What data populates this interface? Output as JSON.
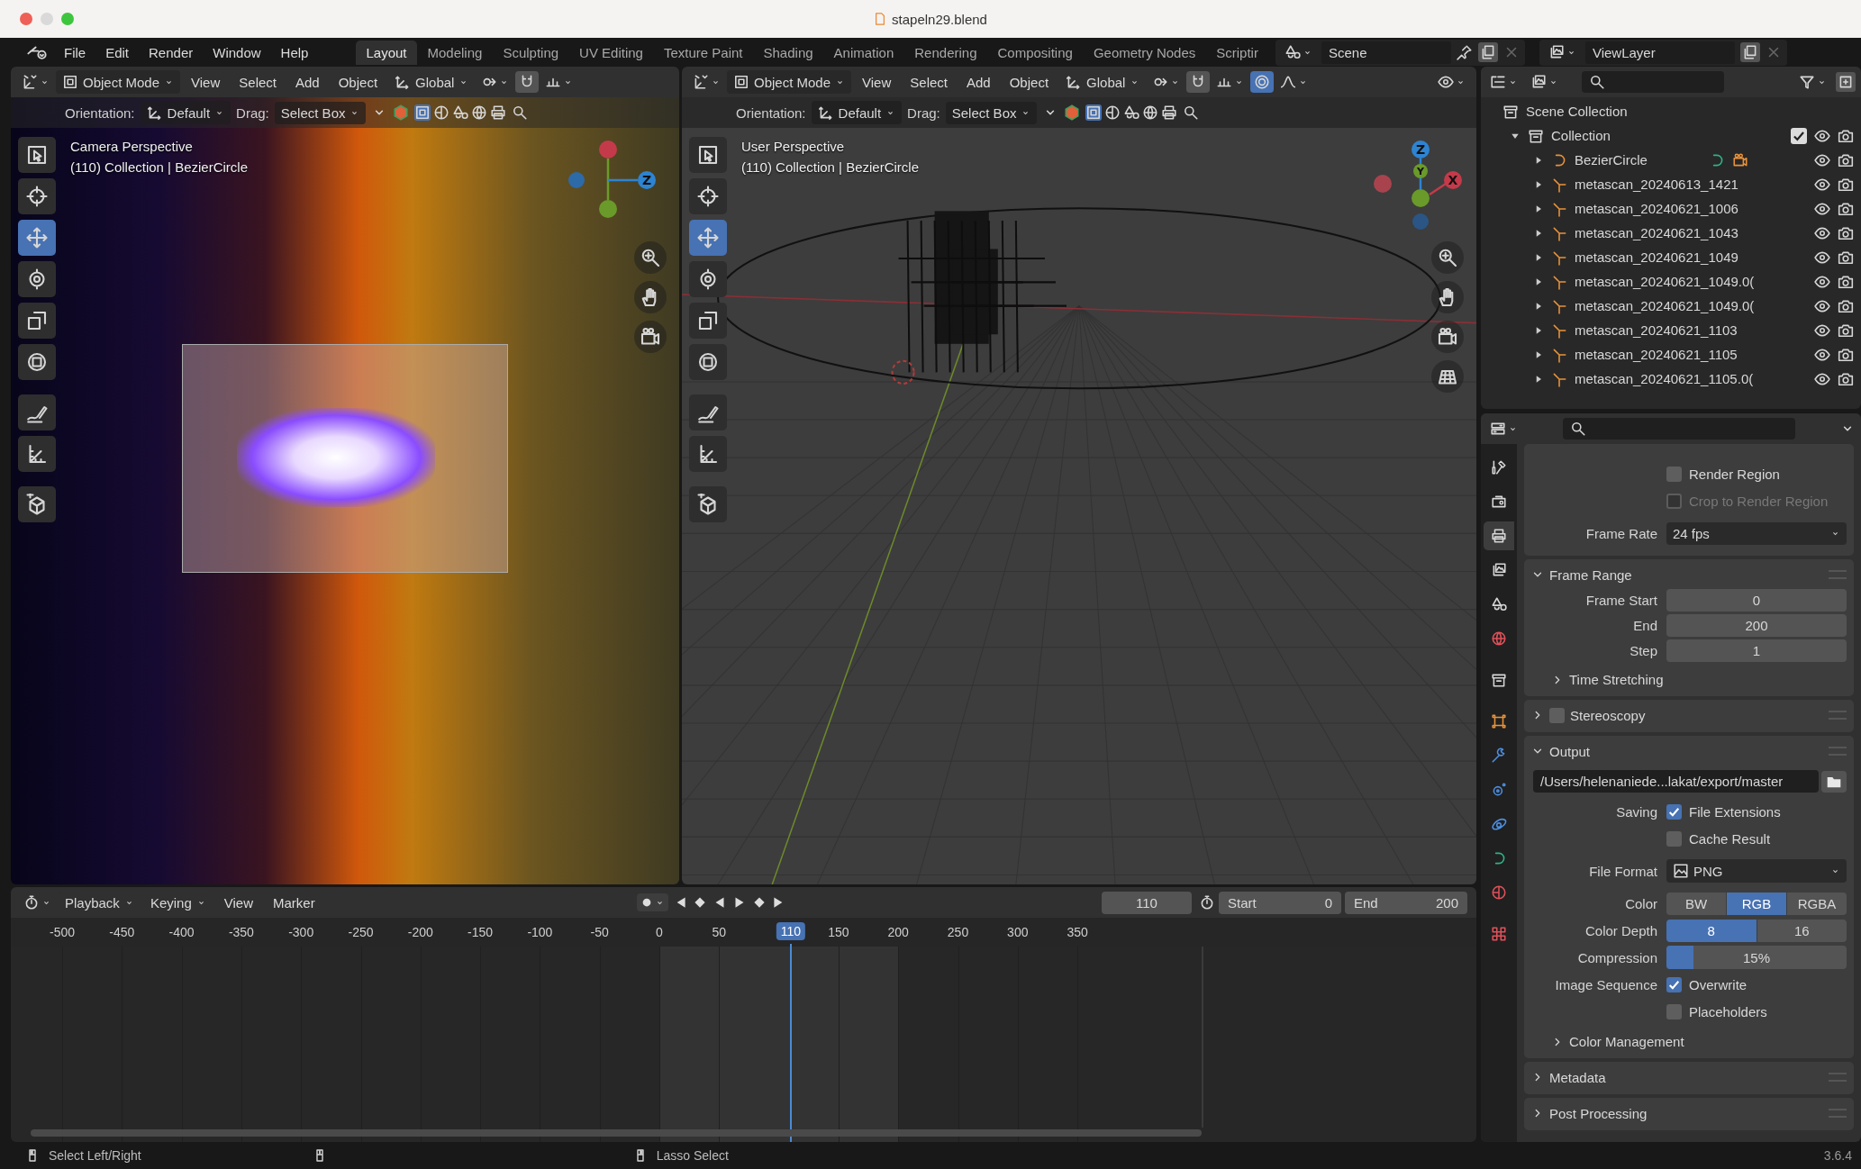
{
  "window": {
    "title": "stapeln29.blend"
  },
  "menu": [
    "File",
    "Edit",
    "Render",
    "Window",
    "Help"
  ],
  "workspaces": [
    {
      "label": "Layout",
      "selected": true
    },
    {
      "label": "Modeling",
      "selected": false
    },
    {
      "label": "Sculpting",
      "selected": false
    },
    {
      "label": "UV Editing",
      "selected": false
    },
    {
      "label": "Texture Paint",
      "selected": false
    },
    {
      "label": "Shading",
      "selected": false
    },
    {
      "label": "Animation",
      "selected": false
    },
    {
      "label": "Rendering",
      "selected": false
    },
    {
      "label": "Compositing",
      "selected": false
    },
    {
      "label": "Geometry Nodes",
      "selected": false
    },
    {
      "label": "Scriptir",
      "selected": false
    }
  ],
  "scene": {
    "value": "Scene"
  },
  "view_layer": {
    "value": "ViewLayer"
  },
  "viewports": [
    {
      "kind": "camera",
      "mode": "Object Mode",
      "menus": [
        "View",
        "Select",
        "Add",
        "Object"
      ],
      "transform": "Global",
      "orientation_label": "Orientation:",
      "orientation": "Default",
      "drag_label": "Drag:",
      "drag": "Select Box",
      "overlay_title": "Camera Perspective",
      "overlay_info": "(110) Collection | BezierCircle",
      "gizmo": [
        "Z"
      ],
      "tools": [
        {
          "kind": "select",
          "selected": false
        },
        {
          "kind": "cursor",
          "selected": false
        },
        {
          "kind": "move",
          "selected": true
        },
        {
          "kind": "rotate",
          "selected": false
        },
        {
          "kind": "scale",
          "selected": false
        },
        {
          "kind": "transform",
          "selected": false
        },
        {
          "kind": "annotate",
          "selected": false
        },
        {
          "kind": "measure",
          "selected": false
        },
        {
          "kind": "add-cube",
          "selected": false
        }
      ],
      "nav": [
        {
          "kind": "zoom"
        },
        {
          "kind": "pan"
        },
        {
          "kind": "camera"
        }
      ]
    },
    {
      "kind": "user",
      "mode": "Object Mode",
      "menus": [
        "View",
        "Select",
        "Add",
        "Object"
      ],
      "transform": "Global",
      "orientation_label": "Orientation:",
      "orientation": "Default",
      "drag_label": "Drag:",
      "drag": "Select Box",
      "overlay_title": "User Perspective",
      "overlay_info": "(110) Collection | BezierCircle",
      "gizmo": [
        "Z",
        "Y",
        "X"
      ],
      "tools": [
        {
          "kind": "select",
          "selected": false
        },
        {
          "kind": "cursor",
          "selected": false
        },
        {
          "kind": "move",
          "selected": true
        },
        {
          "kind": "rotate",
          "selected": false
        },
        {
          "kind": "scale",
          "selected": false
        },
        {
          "kind": "transform",
          "selected": false
        },
        {
          "kind": "annotate",
          "selected": false
        },
        {
          "kind": "measure",
          "selected": false
        },
        {
          "kind": "add-cube",
          "selected": false
        }
      ],
      "nav": [
        {
          "kind": "zoom"
        },
        {
          "kind": "pan"
        },
        {
          "kind": "camera"
        },
        {
          "kind": "grid"
        }
      ]
    }
  ],
  "outliner": {
    "root": "Scene Collection",
    "items": [
      {
        "label": "Collection",
        "kind": "collection",
        "expanded": true,
        "checked": true,
        "children": [
          {
            "label": "BezierCircle",
            "kind": "curve",
            "expanded": false
          },
          {
            "label": "metascan_20240613_1421",
            "kind": "armature",
            "expanded": false
          },
          {
            "label": "metascan_20240621_1006",
            "kind": "armature",
            "expanded": false
          },
          {
            "label": "metascan_20240621_1043",
            "kind": "armature",
            "expanded": false
          },
          {
            "label": "metascan_20240621_1049",
            "kind": "armature",
            "expanded": false
          },
          {
            "label": "metascan_20240621_1049.0(",
            "kind": "armature",
            "expanded": false
          },
          {
            "label": "metascan_20240621_1049.0(",
            "kind": "armature",
            "expanded": false
          },
          {
            "label": "metascan_20240621_1103",
            "kind": "armature",
            "expanded": false
          },
          {
            "label": "metascan_20240621_1105",
            "kind": "armature",
            "expanded": false
          },
          {
            "label": "metascan_20240621_1105.0(",
            "kind": "armature",
            "expanded": false
          }
        ]
      }
    ]
  },
  "properties": {
    "tabs": [
      {
        "kind": "tool",
        "selected": false
      },
      {
        "kind": "render",
        "selected": false
      },
      {
        "kind": "output",
        "selected": true
      },
      {
        "kind": "view-layer",
        "selected": false
      },
      {
        "kind": "scene",
        "selected": false
      },
      {
        "kind": "world",
        "selected": false
      },
      {
        "kind": "collection",
        "selected": false
      },
      {
        "kind": "object",
        "selected": false
      },
      {
        "kind": "modifier",
        "selected": false
      },
      {
        "kind": "particles",
        "selected": false
      },
      {
        "kind": "physics",
        "selected": false
      },
      {
        "kind": "data",
        "selected": false
      },
      {
        "kind": "material",
        "selected": false
      },
      {
        "kind": "texture",
        "selected": false
      }
    ],
    "top_checks": [
      {
        "label": "Render Region",
        "checked": false,
        "disabled": false
      },
      {
        "label": "Crop to Render Region",
        "checked": false,
        "disabled": true
      }
    ],
    "frame_rate": {
      "label": "Frame Rate",
      "value": "24 fps"
    },
    "frame_range": {
      "title": "Frame Range",
      "expanded": true,
      "fields": [
        {
          "label": "Frame Start",
          "value": "0"
        },
        {
          "label": "End",
          "value": "200"
        },
        {
          "label": "Step",
          "value": "1"
        }
      ],
      "subpanel": {
        "title": "Time Stretching",
        "expanded": false
      }
    },
    "stereoscopy": {
      "title": "Stereoscopy",
      "expanded": false,
      "checked": false
    },
    "output": {
      "title": "Output",
      "expanded": true,
      "path": "/Users/helenaniede...lakat/export/master",
      "saving_label": "Saving",
      "saving": [
        {
          "label": "File Extensions",
          "checked": true
        },
        {
          "label": "Cache Result",
          "checked": false
        }
      ],
      "file_format_label": "File Format",
      "file_format": "PNG",
      "color_label": "Color",
      "color_options": [
        {
          "label": "BW",
          "selected": false
        },
        {
          "label": "RGB",
          "selected": true
        },
        {
          "label": "RGBA",
          "selected": false
        }
      ],
      "depth_label": "Color Depth",
      "depth_options": [
        {
          "label": "8",
          "selected": true
        },
        {
          "label": "16",
          "selected": false
        }
      ],
      "compression_label": "Compression",
      "compression": {
        "value": "15%",
        "level": 0.15
      },
      "sequence_label": "Image Sequence",
      "sequence": [
        {
          "label": "Overwrite",
          "checked": true
        },
        {
          "label": "Placeholders",
          "checked": false
        }
      ],
      "subpanel": {
        "title": "Color Management",
        "expanded": false
      }
    },
    "collapsed_panels": [
      {
        "title": "Metadata",
        "expanded": false
      },
      {
        "title": "Post Processing",
        "expanded": false
      }
    ]
  },
  "timeline": {
    "menus": [
      {
        "label": "Playback",
        "kind": "dropdown"
      },
      {
        "label": "Keying",
        "kind": "dropdown"
      },
      {
        "label": "View",
        "kind": "menu"
      },
      {
        "label": "Marker",
        "kind": "menu"
      }
    ],
    "current_frame": "110",
    "start_label": "Start",
    "start": "0",
    "end_label": "End",
    "end": "200",
    "ticks": [
      "-500",
      "-450",
      "-400",
      "-350",
      "-300",
      "-250",
      "-200",
      "-150",
      "-100",
      "-50",
      "0",
      "50",
      "150",
      "200",
      "250",
      "300",
      "350"
    ],
    "playhead": "110"
  },
  "status_bar": {
    "hints": [
      {
        "kind": "left-mouse",
        "label": "Select Left/Right"
      },
      {
        "kind": "middle-mouse"
      },
      {
        "kind": "right-mouse",
        "label": "Lasso Select"
      }
    ],
    "version": "3.6.4"
  }
}
